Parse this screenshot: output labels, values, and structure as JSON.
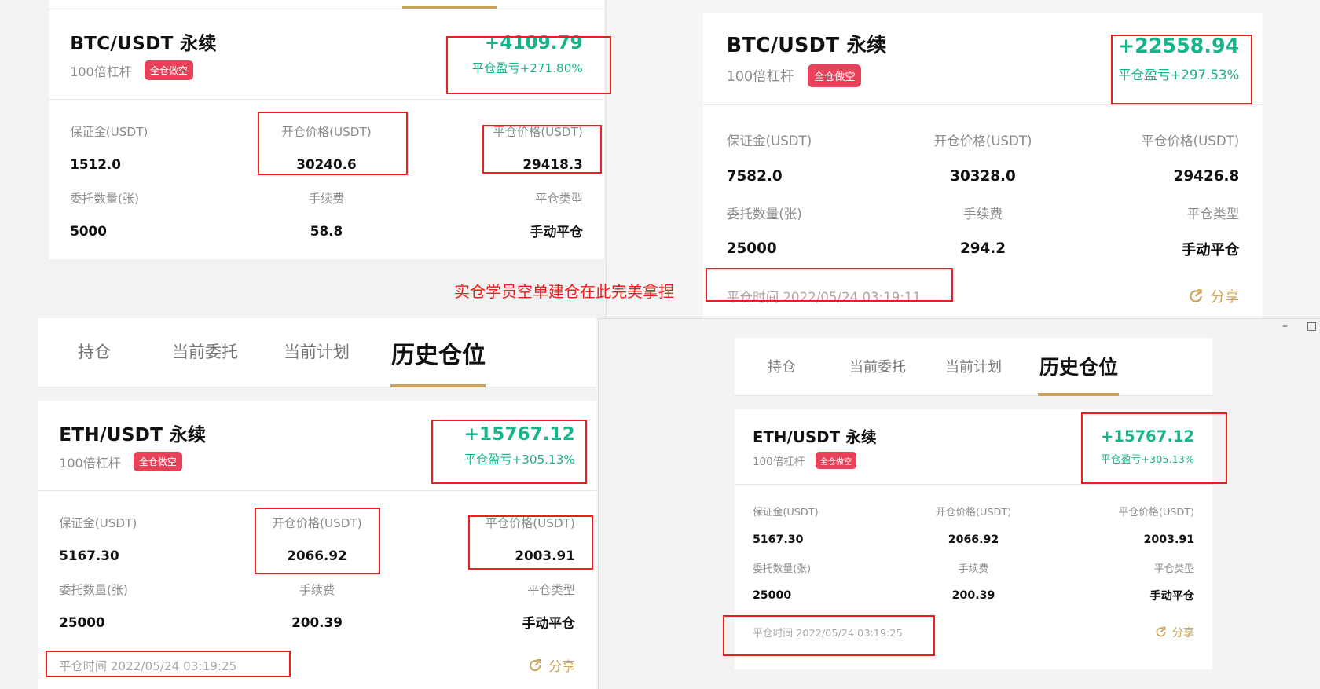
{
  "annotation": "实仓学员空单建仓在此完美拿捏",
  "tabs": [
    {
      "label": "持仓"
    },
    {
      "label": "当前委托"
    },
    {
      "label": "当前计划"
    },
    {
      "label": "历史仓位",
      "active": true
    }
  ],
  "window_controls": {
    "minimize": "–",
    "maximize": "□"
  },
  "colors": {
    "profit": "#17b48c",
    "badge": "#e8425a",
    "accent": "#c9a35a",
    "highlight": "#f21c1c"
  },
  "cards": [
    {
      "title": "BTC/USDT 永续",
      "leverage": "100倍杠杆",
      "badge": "全仓做空",
      "pnl": "+4109.79",
      "pnl_pct": "平仓盈亏+271.80%",
      "fields": [
        {
          "label": "保证金(USDT)",
          "value": "1512.0"
        },
        {
          "label": "开仓价格(USDT)",
          "value": "30240.6"
        },
        {
          "label": "平仓价格(USDT)",
          "value": "29418.3"
        },
        {
          "label": "委托数量(张)",
          "value": "5000"
        },
        {
          "label": "手续费",
          "value": "58.8"
        },
        {
          "label": "平仓类型",
          "value": "手动平仓"
        }
      ]
    },
    {
      "title": "BTC/USDT 永续",
      "leverage": "100倍杠杆",
      "badge": "全仓做空",
      "pnl": "+22558.94",
      "pnl_pct": "平仓盈亏+297.53%",
      "fields": [
        {
          "label": "保证金(USDT)",
          "value": "7582.0"
        },
        {
          "label": "开仓价格(USDT)",
          "value": "30328.0"
        },
        {
          "label": "平仓价格(USDT)",
          "value": "29426.8"
        },
        {
          "label": "委托数量(张)",
          "value": "25000"
        },
        {
          "label": "手续费",
          "value": "294.2"
        },
        {
          "label": "平仓类型",
          "value": "手动平仓"
        }
      ],
      "close_time": "平仓时间 2022/05/24 03:19:11",
      "share": "分享"
    },
    {
      "title": "ETH/USDT 永续",
      "leverage": "100倍杠杆",
      "badge": "全仓做空",
      "pnl": "+15767.12",
      "pnl_pct": "平仓盈亏+305.13%",
      "fields": [
        {
          "label": "保证金(USDT)",
          "value": "5167.30"
        },
        {
          "label": "开仓价格(USDT)",
          "value": "2066.92"
        },
        {
          "label": "平仓价格(USDT)",
          "value": "2003.91"
        },
        {
          "label": "委托数量(张)",
          "value": "25000"
        },
        {
          "label": "手续费",
          "value": "200.39"
        },
        {
          "label": "平仓类型",
          "value": "手动平仓"
        }
      ],
      "close_time": "平仓时间 2022/05/24 03:19:25",
      "share": "分享"
    },
    {
      "title": "ETH/USDT 永续",
      "leverage": "100倍杠杆",
      "badge": "全仓做空",
      "pnl": "+15767.12",
      "pnl_pct": "平仓盈亏+305.13%",
      "fields": [
        {
          "label": "保证金(USDT)",
          "value": "5167.30"
        },
        {
          "label": "开仓价格(USDT)",
          "value": "2066.92"
        },
        {
          "label": "平仓价格(USDT)",
          "value": "2003.91"
        },
        {
          "label": "委托数量(张)",
          "value": "25000"
        },
        {
          "label": "手续费",
          "value": "200.39"
        },
        {
          "label": "平仓类型",
          "value": "手动平仓"
        }
      ],
      "close_time": "平仓时间 2022/05/24 03:19:25",
      "share": "分享"
    }
  ]
}
